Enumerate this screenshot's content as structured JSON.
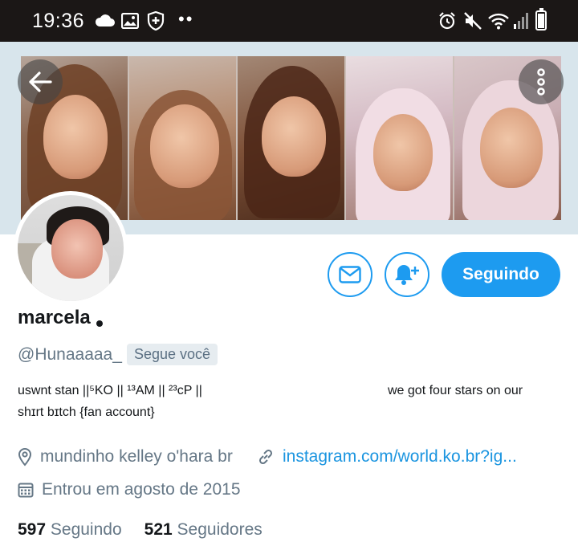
{
  "status_bar": {
    "time": "19:36",
    "left_icons": [
      "cloud-icon",
      "image-icon",
      "shield-icon"
    ],
    "right_icons": [
      "alarm-icon",
      "mute-icon",
      "wifi-icon",
      "signal-icon",
      "battery-icon"
    ],
    "more_dots": "••",
    "battery_level": 0.85
  },
  "header": {
    "back_icon": "arrow-left-icon",
    "overflow_icon": "more-vertical-icon"
  },
  "profile": {
    "name": "marcela",
    "handle": "@Hunaaaaa_",
    "follows_you": "Segue você",
    "bio_line1_left": "uswnt stan ||⁵KO || ¹³AM || ²³cP ||",
    "bio_line1_right": "we got four stars on our",
    "bio_line2": "shɪrt bɪtch {fan account}",
    "location": "mundinho kelley o'hara br",
    "website": "instagram.com/world.ko.br?ig...",
    "joined": "Entrou em agosto de 2015",
    "following_count": "597",
    "following_label": "Seguindo",
    "followers_count": "521",
    "followers_label": "Seguidores"
  },
  "actions": {
    "message_icon": "mail-icon",
    "notify_icon": "bell-plus-icon",
    "follow_button_label": "Seguindo"
  },
  "colors": {
    "accent": "#1d9bf0",
    "secondary_text": "#657786",
    "status_bar_bg": "#1b1716",
    "banner_bg": "#d8e5ec"
  }
}
